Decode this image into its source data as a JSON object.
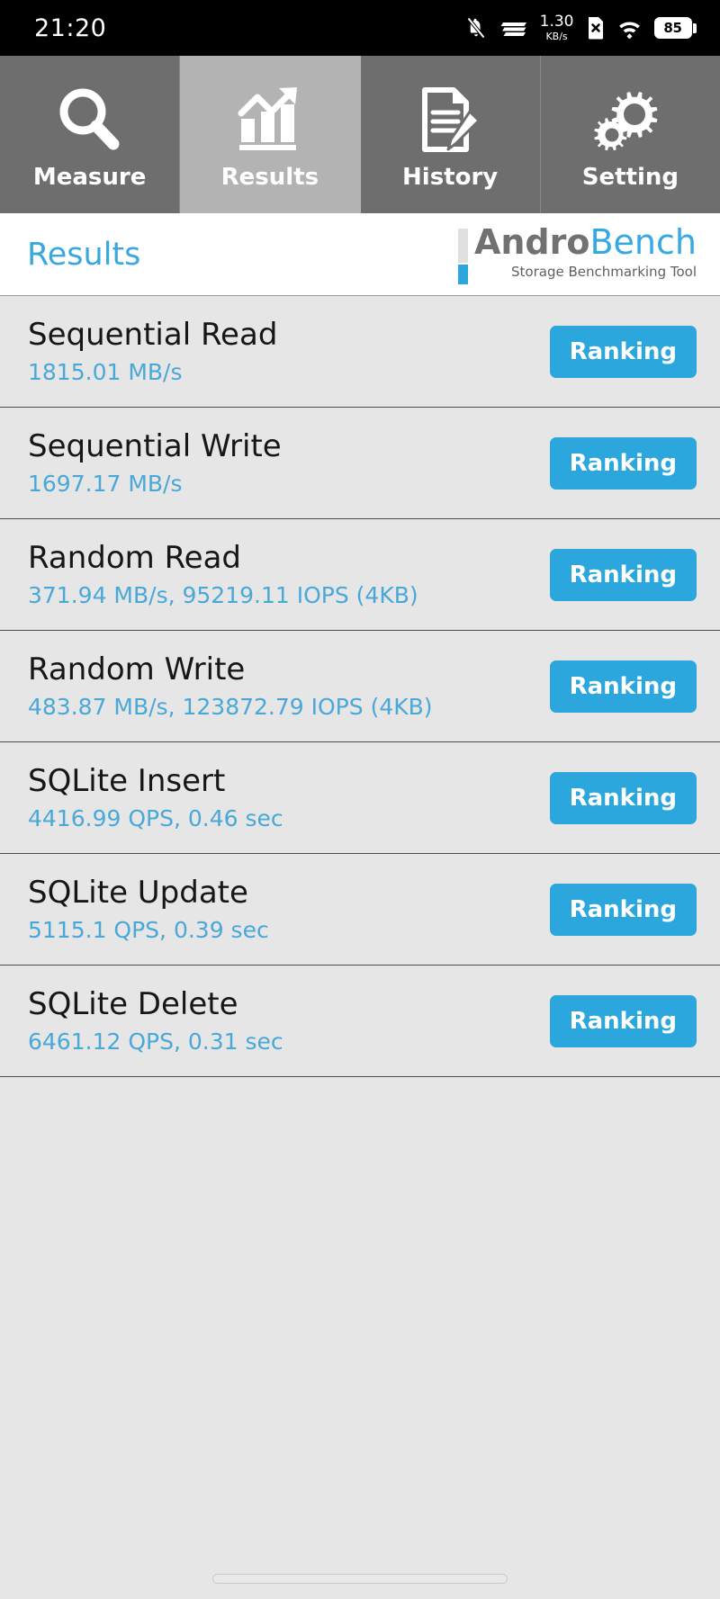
{
  "status_bar": {
    "clock": "21:20",
    "icons": [
      {
        "name": "bell-slash-icon",
        "label": "mute"
      },
      {
        "name": "signal-bars-icon",
        "label": "signal"
      },
      {
        "name": "sd-card-x-icon",
        "label": "no-sim"
      },
      {
        "name": "wifi-icon",
        "label": "wifi"
      }
    ],
    "net_speed_value": "1.30",
    "net_speed_unit": "KB/s",
    "battery_level": "85"
  },
  "tabs": [
    {
      "label": "Measure",
      "icon": "magnifier-icon",
      "active": false
    },
    {
      "label": "Results",
      "icon": "bar-chart-arrow-icon",
      "active": true
    },
    {
      "label": "History",
      "icon": "document-pencil-icon",
      "active": false
    },
    {
      "label": "Setting",
      "icon": "gears-icon",
      "active": false
    }
  ],
  "header": {
    "page_title": "Results",
    "brand_first": "Andro",
    "brand_second": "Bench",
    "brand_subtitle": "Storage Benchmarking Tool"
  },
  "results": {
    "ranking_label": "Ranking",
    "rows": [
      {
        "title": "Sequential Read",
        "value": "1815.01 MB/s"
      },
      {
        "title": "Sequential Write",
        "value": "1697.17 MB/s"
      },
      {
        "title": "Random Read",
        "value": "371.94 MB/s, 95219.11 IOPS (4KB)"
      },
      {
        "title": "Random Write",
        "value": "483.87 MB/s, 123872.79 IOPS (4KB)"
      },
      {
        "title": "SQLite Insert",
        "value": "4416.99 QPS, 0.46 sec"
      },
      {
        "title": "SQLite Update",
        "value": "5115.1 QPS, 0.39 sec"
      },
      {
        "title": "SQLite Delete",
        "value": "6461.12 QPS, 0.31 sec"
      }
    ]
  },
  "colors": {
    "accent_blue": "#2ba7de",
    "value_blue": "#4aa8d8",
    "tab_inactive": "#6e6e6e",
    "tab_active": "#b3b3b3",
    "list_bg": "#e6e6e6"
  }
}
